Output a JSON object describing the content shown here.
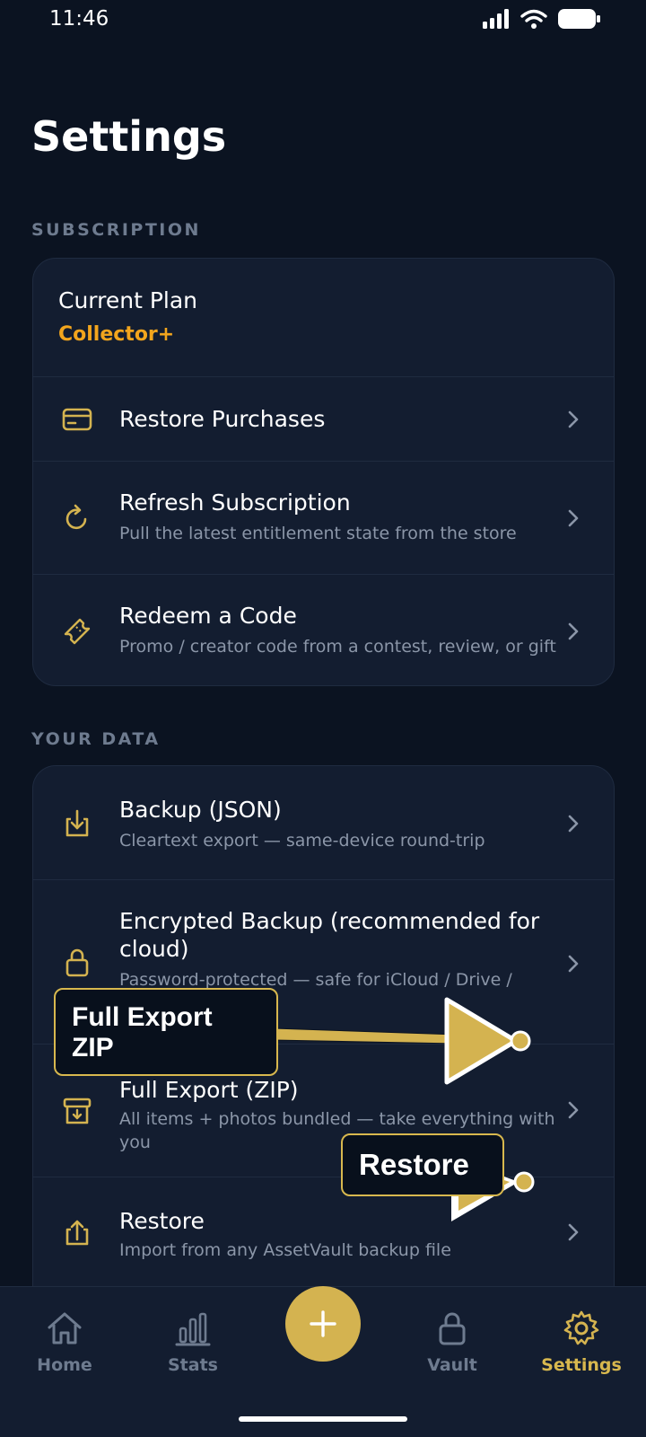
{
  "status_bar": {
    "time": "11:46"
  },
  "header": {
    "title": "Settings"
  },
  "subscription": {
    "section_label": "SUBSCRIPTION",
    "current_plan_label": "Current Plan",
    "current_plan_value": "Collector+",
    "items": [
      {
        "title": "Restore Purchases",
        "subtitle": "",
        "icon": "credit-card-icon"
      },
      {
        "title": "Refresh Subscription",
        "subtitle": "Pull the latest entitlement state from the store",
        "icon": "refresh-icon"
      },
      {
        "title": "Redeem a Code",
        "subtitle": "Promo / creator code from a contest, review, or gift",
        "icon": "ticket-icon"
      }
    ]
  },
  "your_data": {
    "section_label": "YOUR DATA",
    "items": [
      {
        "title": "Backup (JSON)",
        "subtitle": "Cleartext export — same-device round-trip",
        "icon": "download-icon"
      },
      {
        "title": "Encrypted Backup (recommended for cloud)",
        "subtitle": "Password-protected — safe for iCloud / Drive /",
        "icon": "lock-icon"
      },
      {
        "title": "Full Export (ZIP)",
        "subtitle": "All items + photos bundled — take everything with you",
        "icon": "archive-icon"
      },
      {
        "title": "Restore",
        "subtitle": "Import from any AssetVault backup file",
        "icon": "upload-icon"
      }
    ]
  },
  "annotations": {
    "full_export": "Full Export ZIP",
    "restore": "Restore"
  },
  "bottom_nav": {
    "items": [
      {
        "label": "Home",
        "icon": "home-icon"
      },
      {
        "label": "Stats",
        "icon": "bar-chart-icon"
      },
      {
        "label": "Vault",
        "icon": "lock-icon"
      },
      {
        "label": "Settings",
        "icon": "gear-icon",
        "active": true
      }
    ],
    "fab_icon": "plus-icon"
  },
  "colors": {
    "background": "#0b1321",
    "card": "#131d30",
    "accent_gold": "#d4b350",
    "plan_orange": "#f2a51d",
    "muted_text": "#8b96a8"
  }
}
